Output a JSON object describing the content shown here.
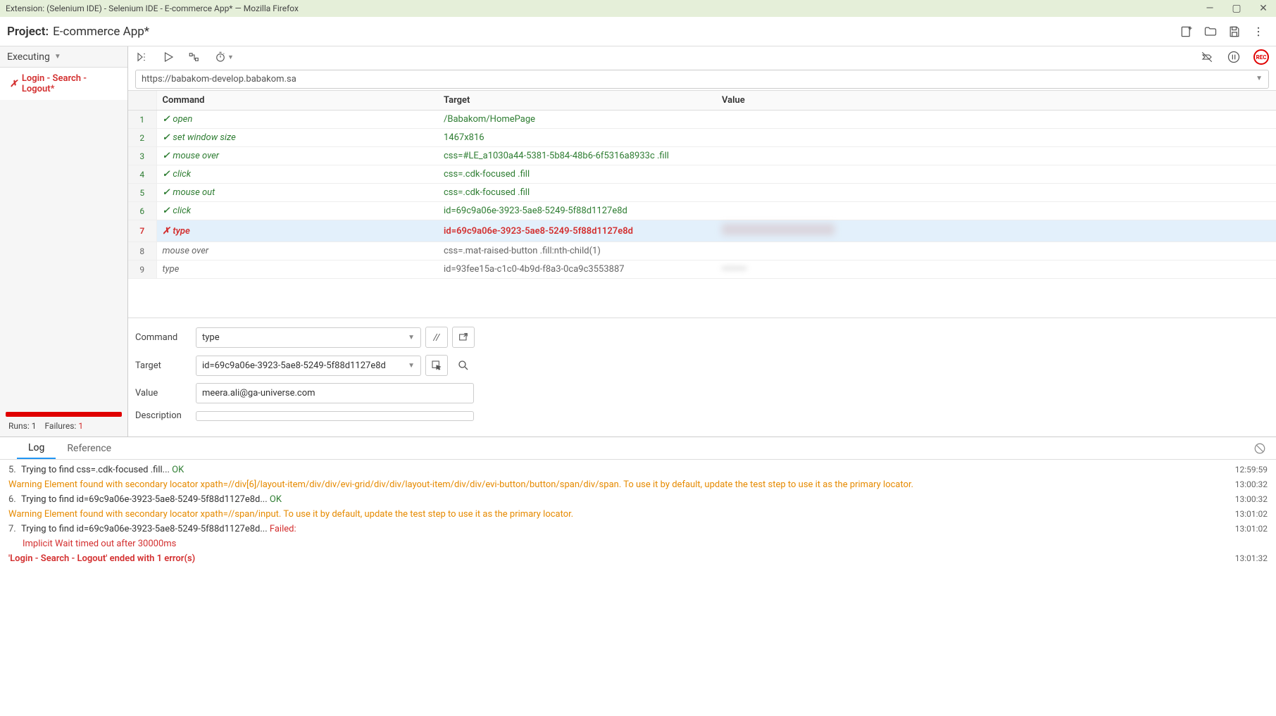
{
  "titlebar": "Extension: (Selenium IDE) - Selenium IDE - E-commerce App* — Mozilla Firefox",
  "project_prefix": "Project:",
  "project_name": "E-commerce App*",
  "sidebar": {
    "dropdown": "Executing",
    "test": {
      "name": "Login - Search - Logout*"
    },
    "runs_label": "Runs:",
    "runs": "1",
    "failures_label": "Failures:",
    "failures": "1"
  },
  "url": "https://babakom-develop.babakom.sa",
  "columns": {
    "cmd": "Command",
    "tgt": "Target",
    "val": "Value"
  },
  "rows": [
    {
      "n": "1",
      "status": "passed",
      "cmd": "open",
      "tgt": "/Babakom/HomePage",
      "val": ""
    },
    {
      "n": "2",
      "status": "passed",
      "cmd": "set window size",
      "tgt": "1467x816",
      "val": ""
    },
    {
      "n": "3",
      "status": "passed",
      "cmd": "mouse over",
      "tgt": "css=#LE_a1030a44-5381-5b84-48b6-6f5316a8933c .fill",
      "val": ""
    },
    {
      "n": "4",
      "status": "passed",
      "cmd": "click",
      "tgt": "css=.cdk-focused .fill",
      "val": ""
    },
    {
      "n": "5",
      "status": "passed",
      "cmd": "mouse out",
      "tgt": "css=.cdk-focused .fill",
      "val": ""
    },
    {
      "n": "6",
      "status": "passed",
      "cmd": "click",
      "tgt": "id=69c9a06e-3923-5ae8-5249-5f88d1127e8d",
      "val": ""
    },
    {
      "n": "7",
      "status": "failed",
      "cmd": "type",
      "tgt": "id=69c9a06e-3923-5ae8-5249-5f88d1127e8d",
      "val": "(redacted)"
    },
    {
      "n": "8",
      "status": "pending",
      "cmd": "mouse over",
      "tgt": "css=.mat-raised-button .fill:nth-child(1)",
      "val": ""
    },
    {
      "n": "9",
      "status": "pending",
      "cmd": "type",
      "tgt": "id=93fee15a-c1c0-4b9d-f8a3-0ca9c3553887",
      "val": "(redacted)"
    }
  ],
  "detail": {
    "command_lbl": "Command",
    "command_val": "type",
    "target_lbl": "Target",
    "target_val": "id=69c9a06e-3923-5ae8-5249-5f88d1127e8d",
    "value_lbl": "Value",
    "value_val": "meera.ali@ga-universe.com",
    "desc_lbl": "Description",
    "desc_val": ""
  },
  "tabs": {
    "log": "Log",
    "ref": "Reference"
  },
  "log": [
    {
      "type": "step",
      "n": "5.",
      "msg": "Trying to find css=.cdk-focused .fill... ",
      "status": "OK",
      "ts": "12:59:59"
    },
    {
      "type": "warn",
      "msg": "Warning Element found with secondary locator xpath=//div[6]/layout-item/div/div/evi-grid/div/div/layout-item/div/div/evi-button/button/span/div/span. To use it by default, update the test step to use it as the primary locator.",
      "ts": "13:00:32"
    },
    {
      "type": "step",
      "n": "6.",
      "msg": "Trying to find id=69c9a06e-3923-5ae8-5249-5f88d1127e8d... ",
      "status": "OK",
      "ts": "13:00:32"
    },
    {
      "type": "warn",
      "msg": "Warning Element found with secondary locator xpath=//span/input. To use it by default, update the test step to use it as the primary locator.",
      "ts": "13:01:02"
    },
    {
      "type": "step-fail",
      "n": "7.",
      "msg": "Trying to find id=69c9a06e-3923-5ae8-5249-5f88d1127e8d... ",
      "status": "Failed:",
      "ts": "13:01:02"
    },
    {
      "type": "fail-sub",
      "msg": "Implicit Wait timed out after 30000ms",
      "ts": ""
    },
    {
      "type": "summary",
      "msg": "'Login - Search - Logout' ended with 1 error(s)",
      "ts": "13:01:32"
    }
  ]
}
